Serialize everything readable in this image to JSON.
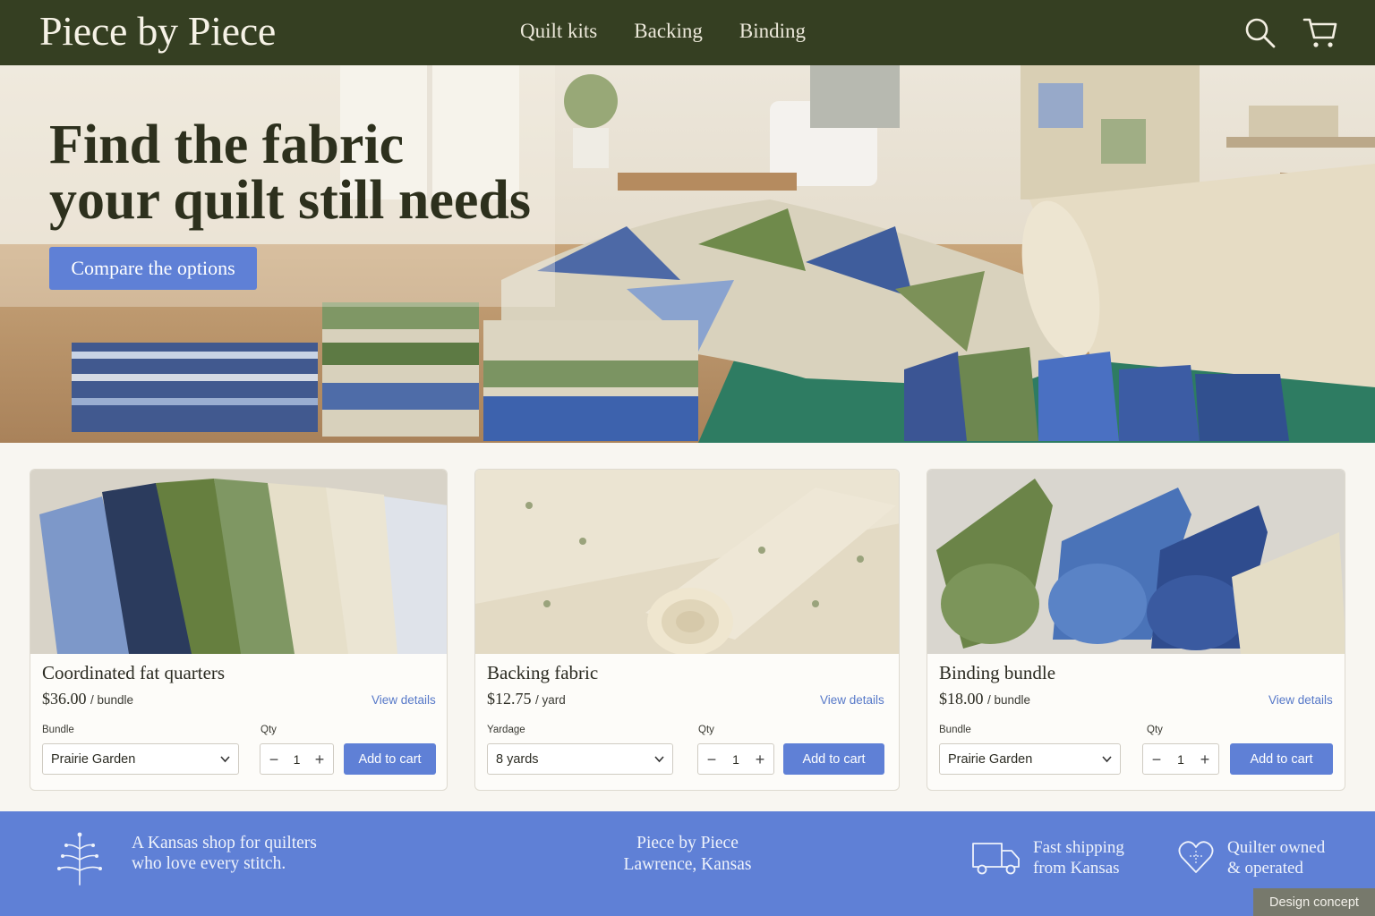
{
  "header": {
    "brand": "Piece by Piece",
    "nav": [
      "Quilt kits",
      "Backing",
      "Binding"
    ],
    "icons": [
      "search-icon",
      "cart-icon"
    ]
  },
  "hero": {
    "title_line1": "Find the fabric",
    "title_line2": "your quilt still needs",
    "cta": "Compare the options"
  },
  "products": [
    {
      "name": "Coordinated fat quarters",
      "price": "$36.00",
      "unit": "/ bundle",
      "view": "View details",
      "option_label": "Bundle",
      "option_value": "Prairie Garden",
      "qty_label": "Qty",
      "qty": "1",
      "add": "Add to cart"
    },
    {
      "name": "Backing fabric",
      "price": "$12.75",
      "unit": "/ yard",
      "view": "View details",
      "option_label": "Yardage",
      "option_value": "8 yards",
      "qty_label": "Qty",
      "qty": "1",
      "add": "Add to cart"
    },
    {
      "name": "Binding bundle",
      "price": "$18.00",
      "unit": "/ bundle",
      "view": "View details",
      "option_label": "Bundle",
      "option_value": "Prairie Garden",
      "qty_label": "Qty",
      "qty": "1",
      "add": "Add to cart"
    }
  ],
  "footer": {
    "tagline_line1": "A Kansas shop for quilters",
    "tagline_line2": "who love every stitch.",
    "shop_name": "Piece by Piece",
    "location": "Lawrence, Kansas",
    "shipping_line1": "Fast shipping",
    "shipping_line2": "from Kansas",
    "owned_line1": "Quilter owned",
    "owned_line2": "& operated"
  },
  "badge": "Design concept",
  "colors": {
    "header_bg": "#353f22",
    "accent": "#5f80d6",
    "page_bg": "#f8f6f1"
  }
}
